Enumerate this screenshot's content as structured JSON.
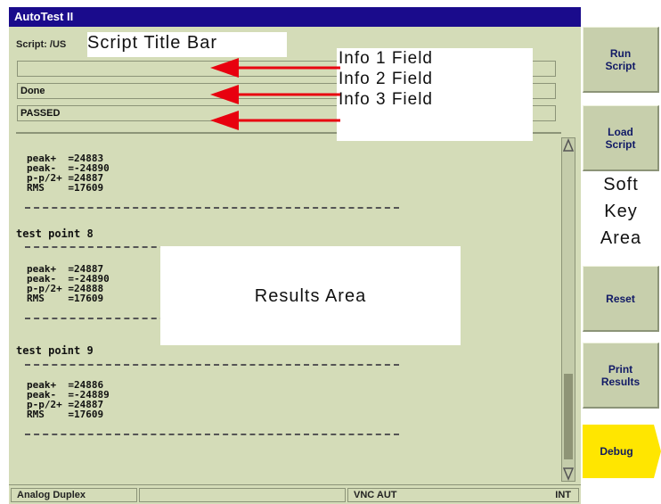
{
  "window": {
    "title": "AutoTest II",
    "script_label": "Script: /US",
    "info1_value": "",
    "info2_value": "Done",
    "info3_value": "PASSED"
  },
  "results": {
    "blocks": [
      {
        "rows": [
          "peak+  =24883",
          "peak-  =-24890",
          "p-p/2+ =24887",
          "RMS    =17609"
        ]
      },
      {
        "heading": "test point 8",
        "rows": [
          "peak+  =24887",
          "peak-  =-24890",
          "p-p/2+ =24888",
          "RMS    =17609"
        ]
      },
      {
        "heading": "test point 9",
        "rows": [
          "peak+  =24886",
          "peak-  =-24889",
          "p-p/2+ =24887",
          "RMS    =17609"
        ]
      }
    ]
  },
  "softkeys": {
    "run": [
      "Run",
      "Script"
    ],
    "load": [
      "Load",
      "Script"
    ],
    "reset": "Reset",
    "print": [
      "Print",
      "Results"
    ],
    "debug": "Debug"
  },
  "status": {
    "mode": "Analog Duplex",
    "blank": "",
    "source": "VNC AUT",
    "clock": "INT"
  },
  "annotations": {
    "script_title": "Script Title Bar",
    "info1": "Info 1 Field",
    "info2": "Info 2 Field",
    "info3": "Info 3 Field",
    "results": "Results Area",
    "softkey": [
      "Soft",
      "Key",
      "Area"
    ]
  },
  "colors": {
    "title_bar": "#1a0b8c",
    "panel": "#d4dcb8",
    "debug_key": "#ffe600",
    "arrow": "#e8000f"
  },
  "icons": {
    "scroll_up": "triangle-up-icon",
    "scroll_down": "triangle-down-icon",
    "debug": "arrow-tab-right-icon"
  }
}
